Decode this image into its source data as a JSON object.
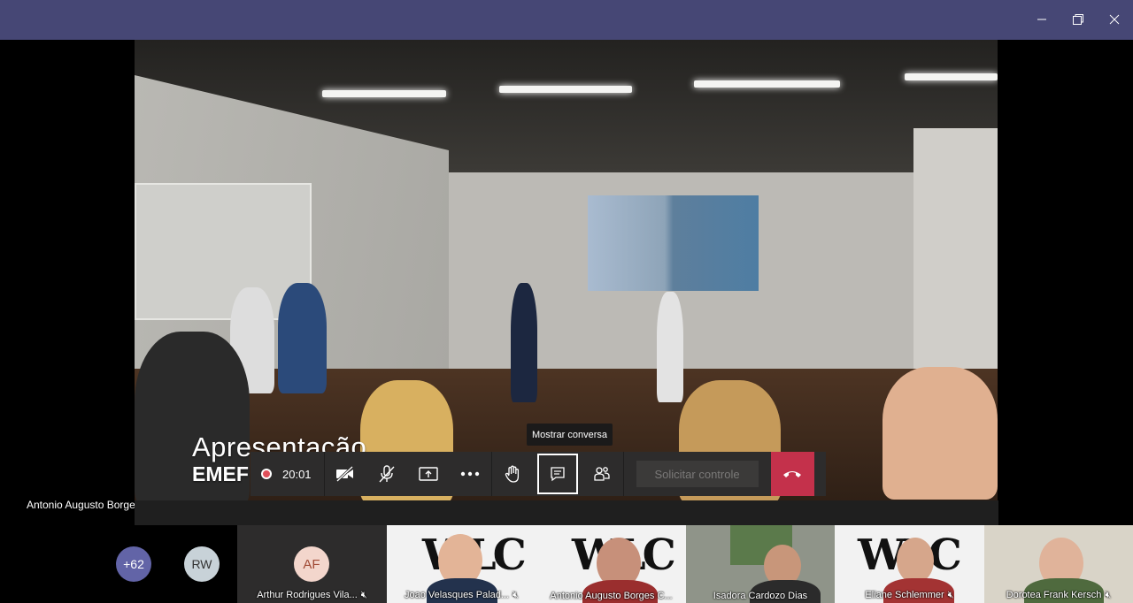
{
  "window": {
    "minimize_icon": "minimize-icon",
    "restore_icon": "restore-icon",
    "close_icon": "close-icon"
  },
  "stage": {
    "presenter_name": "Antonio Augusto Borges Coelho",
    "overlay_title": "Apresentação",
    "overlay_subtitle": "EMEF"
  },
  "call_controls": {
    "timer": "20:01",
    "tooltip": "Mostrar conversa",
    "request_control": "Solicitar controle",
    "buttons": [
      "camera-off-icon",
      "mic-off-icon",
      "share-screen-icon",
      "more-icon",
      "raise-hand-icon",
      "chat-icon",
      "participants-icon",
      "hang-up-icon"
    ]
  },
  "gallery": {
    "overflow_count": "+62",
    "avatar_rw": "RW",
    "avatar_af": "AF",
    "participants": [
      {
        "name": "Arthur Rodrigues Vila..."
      },
      {
        "name": "Joao Velasques Palad..."
      },
      {
        "name": "Antonio Augusto Borges C..."
      },
      {
        "name": "Isadora Cardozo Dias"
      },
      {
        "name": "Eliane Schlemmer"
      },
      {
        "name": "Dorotea Frank Kersch"
      }
    ]
  },
  "colors": {
    "titlebar": "#464775",
    "hangup": "#c4314b",
    "rec": "#e0505a",
    "avatar_overflow": "#6264a7"
  }
}
